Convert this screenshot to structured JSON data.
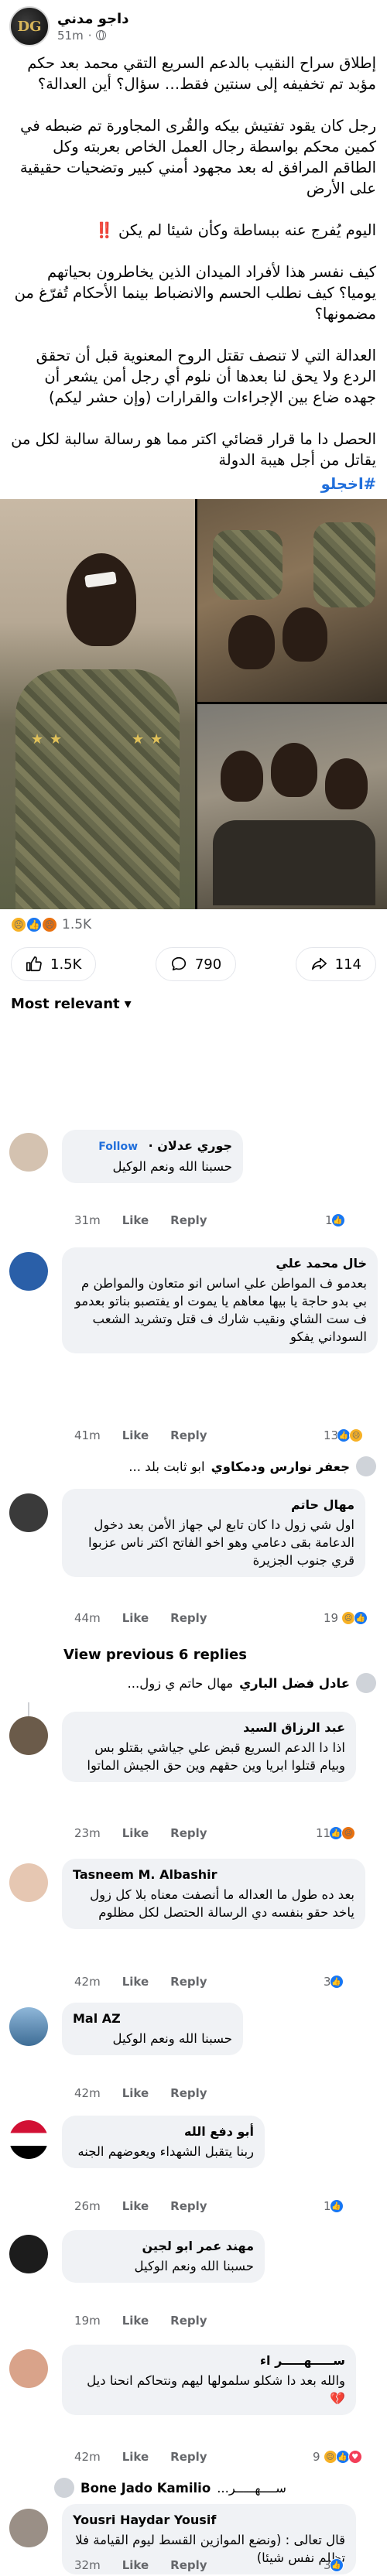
{
  "post": {
    "author": "داجو مدني",
    "time": "51m",
    "avatar_text": "DG",
    "paragraphs": [
      "إطلاق سراح النقيب بالدعم السريع التقي محمد بعد حكم مؤبد تم تخفيفه إلى سنتين فقط… سؤال؟ أين العدالة؟",
      "رجل كان يقود تفتيش بيكه والقُرى المجاورة تم ضبطه في كمين محكم بواسطة رجال العمل الخاص بعربته وكل الطاقم المرافق له بعد مجهود أمني كبير وتضحيات حقيقية على الأرض",
      "اليوم يُفرج عنه ببساطة وكأن شيئا لم يكن",
      "كيف نفسر هذا لأفراد الميدان الذين يخاطرون بحياتهم يوميا؟ كيف نطلب الحسم والانضباط بينما الأحكام تُفرّغ من مضمونها؟",
      "العدالة التي لا تنصف تقتل الروح المعنوية قبل أن تحقق الردع ولا يحق لنا بعدها أن نلوم أي رجل أمن يشعر أن جهده ضاع بين الإجراءات والقرارات (وإن حشر ليكم)",
      "الحصل دا ما قرار قضائي اكتر مما هو رسالة سالبة لكل من يقاتل من أجل هيبة الدولة"
    ],
    "red_mark": "‼️",
    "hashtag": "#اخجلو",
    "reaction_count": "1.5K",
    "actions": {
      "like": "1.5K",
      "comment": "790",
      "share": "114"
    }
  },
  "sort_label": "Most relevant",
  "labels": {
    "like": "Like",
    "reply": "Reply",
    "follow": "Follow",
    "view_previous": "View previous 6 replies"
  },
  "comments": [
    {
      "name": "جوري عدلان",
      "text": "حسبنا الله ونعم الوكيل",
      "time": "31m",
      "count": "1",
      "follow": true
    },
    {
      "name": "خال محمد علي",
      "text": "بعدمو ف المواطن علي اساس انو متعاون والمواطن م بي بدو حاجة يا بيها معاهم يا يموت او يفتصبو بناتو بعدمو ف ست الشاي ونقيب شارك ف قتل وتشريد الشعب السوداني يفكو",
      "time": "41m",
      "count": "13"
    },
    {
      "name": "جعفر نوارس ودمكاوي",
      "prefix": "ابو ثابت بلد ...",
      "text": ""
    },
    {
      "name": "مهال حاتم",
      "text": "اول شي زول دا كان تابع لي جهاز الأمن بعد دخول الدعامة بقى دعامي وهو اخو الفاتح اكتر ناس عزبوا قري جنوب الجزيرة",
      "time": "44m",
      "count": "19"
    },
    {
      "name": "عادل فضل الباري",
      "prefix": "مهال حاتم ي زول...",
      "text": ""
    },
    {
      "name": "عبد الرزاق السيد",
      "text": "اذا دا الدعم السريع قبض علي جياشي بقتلو بس وبيام قتلوا ابريا وين حقهم وين حق الجيش الماتوا",
      "time": "23m",
      "count": "11"
    },
    {
      "name": "Tasneem M. Albashir",
      "text": "بعد ده طول ما العداله ما أنصفت معناه بلا كل زول ياخد حقو بنفسه دي الرسالة الحتصل لكل مظلوم",
      "time": "42m",
      "count": "3"
    },
    {
      "name": "Mal AZ",
      "text": "حسبنا الله ونعم الوكيل",
      "time": "42m"
    },
    {
      "name": "أبو دفع الله",
      "text": "ربنا يتقبل الشهداء ويعوضهم الجنه",
      "time": "26m",
      "count": "1"
    },
    {
      "name": "مهند عمر ابو لجين",
      "text": "حسبنا الله ونعم الوكيل",
      "time": "19m"
    },
    {
      "name": "ســـــهـــــر اء",
      "text": "والله بعد دا شكلو سلمولها ليهم ونتحاكم انحنا ديل",
      "time": "42m",
      "count": "9"
    },
    {
      "name": "Bone Jado Kamilio",
      "prefix": "ســــهـــــر...",
      "text": ""
    },
    {
      "name": "Yousri Haydar Yousif",
      "text": "قال تعالى : (ونضع الموازين القسط ليوم القيامة فلا تظلم نفس شيئا)",
      "time": "32m",
      "count": "3"
    }
  ],
  "colors": {
    "accent": "#1877f2",
    "link": "#216fdb",
    "bubble": "#f0f2f5",
    "muted": "#65676b"
  },
  "icons": [
    "globe-icon",
    "like-icon",
    "comment-icon",
    "share-icon",
    "chevron-down-icon",
    "sad-reaction-icon",
    "like-reaction-icon",
    "angry-reaction-icon",
    "broken-heart-icon"
  ]
}
